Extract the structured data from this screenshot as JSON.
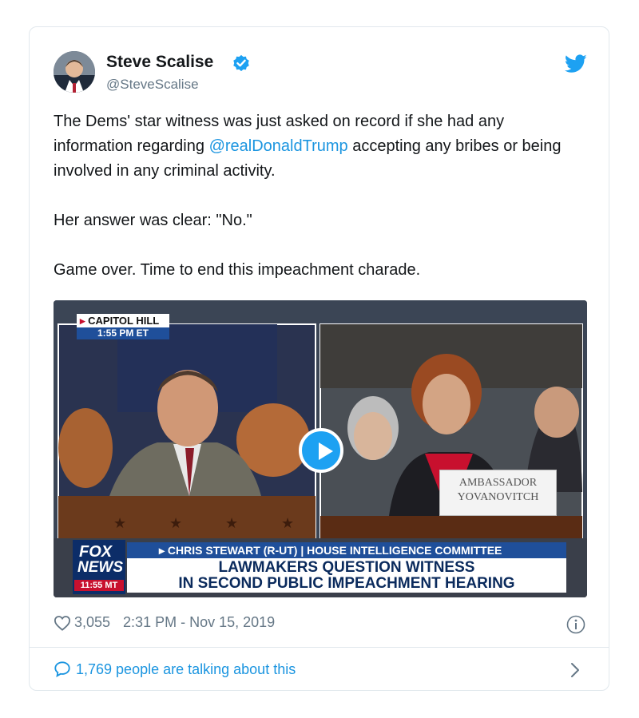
{
  "author": {
    "name": "Steve Scalise",
    "handle": "@SteveScalise",
    "verified": true
  },
  "tweet": {
    "line1_before": "The Dems' star witness was just asked on record if she had any information regarding ",
    "mention": "@realDonaldTrump",
    "line1_after": " accepting any bribes or being involved in any criminal activity.",
    "para2": "Her answer was clear: \"No.\"",
    "para3": "Game over. Time to end this impeachment charade."
  },
  "media": {
    "location_tag": "CAPITOL HILL",
    "location_time": "1:55 PM ET",
    "nameplate_line1": "AMBASSADOR",
    "nameplate_line2": "YOVANOVITCH",
    "logo_line1": "FOX",
    "logo_line2": "NEWS",
    "logo_time": "11:55 MT",
    "chyron_top": "CHRIS STEWART (R-UT) | HOUSE INTELLIGENCE COMMITTEE",
    "chyron_line1": "LAWMAKERS QUESTION WITNESS",
    "chyron_line2": "IN SECOND PUBLIC IMPEACHMENT HEARING"
  },
  "meta": {
    "likes": "3,055",
    "timestamp": "2:31 PM - Nov 15, 2019"
  },
  "footer": {
    "talking": "1,769 people are talking about this"
  },
  "colors": {
    "link": "#1b95e0",
    "verified": "#1da1f2",
    "muted": "#657786",
    "border": "#e1e8ed"
  },
  "icons": [
    "verified-badge-icon",
    "twitter-bird-icon",
    "play-icon",
    "heart-icon",
    "info-icon",
    "speech-bubble-icon",
    "chevron-right-icon"
  ]
}
